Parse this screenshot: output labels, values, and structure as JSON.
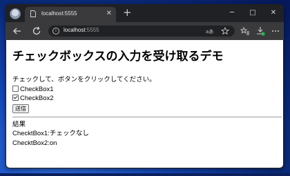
{
  "browser": {
    "tab_title": "localhost:5555",
    "tab_close": "✕",
    "new_tab": "+",
    "url_host": "localhost",
    "url_port": ":5555",
    "controls": {
      "minimize": "─",
      "maximize": "□",
      "close": "✕"
    },
    "icons": {
      "back": "arrow-left-icon",
      "forward": "arrow-right-icon",
      "reload": "reload-icon",
      "info": "info-icon",
      "reader": "read-aloud-icon",
      "favorite": "star-icon",
      "favorites": "favorites-icon",
      "downloads": "download-icon",
      "menu": "ellipsis-icon"
    },
    "colors": {
      "frame": "#202124",
      "toolbar": "#3a3a3d",
      "download_badge": "#2fb34a"
    }
  },
  "page": {
    "heading": "チェックボックスの入力を受け取るデモ",
    "instruction": "チェックして、ボタンをクリックしてください。",
    "checkboxes": [
      {
        "label": "CheckBox1",
        "checked": false
      },
      {
        "label": "CheckBox2",
        "checked": true
      }
    ],
    "submit_label": "送信",
    "result": {
      "title": "結果",
      "line1": "ChecktBox1:チェックなし",
      "line2": "ChecktBox2:on"
    }
  }
}
